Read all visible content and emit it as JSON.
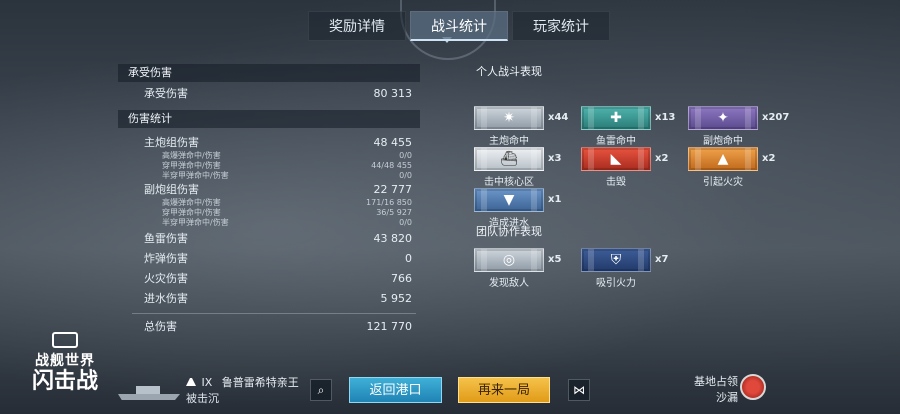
{
  "tabs": [
    "奖励详情",
    "战斗统计",
    "玩家统计"
  ],
  "active_tab": 1,
  "damage_received": {
    "header": "承受伤害",
    "label": "承受伤害",
    "value": "80 313"
  },
  "damage_stats": {
    "header": "伤害统计",
    "main_battery": {
      "label": "主炮组伤害",
      "value": "48 455"
    },
    "main_sub": [
      {
        "label": "高爆弹命中/伤害",
        "value": "0/0"
      },
      {
        "label": "穿甲弹命中/伤害",
        "value": "44/48 455"
      },
      {
        "label": "半穿甲弹命中/伤害",
        "value": "0/0"
      }
    ],
    "secondary": {
      "label": "副炮组伤害",
      "value": "22 777"
    },
    "secondary_sub": [
      {
        "label": "高爆弹命中/伤害",
        "value": "171/16 850"
      },
      {
        "label": "穿甲弹命中/伤害",
        "value": "36/5 927"
      },
      {
        "label": "半穿甲弹命中/伤害",
        "value": "0/0"
      }
    ],
    "others": [
      {
        "label": "鱼雷伤害",
        "value": "43 820"
      },
      {
        "label": "炸弹伤害",
        "value": "0"
      },
      {
        "label": "火灾伤害",
        "value": "766"
      },
      {
        "label": "进水伤害",
        "value": "5 952"
      }
    ],
    "total": {
      "label": "总伤害",
      "value": "121 770"
    }
  },
  "personal": {
    "header": "个人战斗表现",
    "medals": [
      {
        "label": "主炮命中",
        "count": "x44",
        "icon": "shell-icon"
      },
      {
        "label": "鱼雷命中",
        "count": "x13",
        "icon": "torpedo-icon"
      },
      {
        "label": "副炮命中",
        "count": "x207",
        "icon": "secondary-gun-icon"
      },
      {
        "label": "击中核心区",
        "count": "x3",
        "icon": "citadel-icon"
      },
      {
        "label": "击毁",
        "count": "x2",
        "icon": "destroyed-icon"
      },
      {
        "label": "引起火灾",
        "count": "x2",
        "icon": "fire-icon"
      },
      {
        "label": "造成进水",
        "count": "x1",
        "icon": "flooding-icon"
      }
    ]
  },
  "team": {
    "header": "团队协作表现",
    "medals": [
      {
        "label": "发现敌人",
        "count": "x5",
        "icon": "spotting-icon"
      },
      {
        "label": "吸引火力",
        "count": "x7",
        "icon": "tank-fire-icon"
      }
    ]
  },
  "logo": {
    "line1": "战舰世界",
    "line2": "闪击战"
  },
  "ship": {
    "tier": "IX",
    "name": "鲁普雷希特亲王",
    "status": "被击沉"
  },
  "buttons": {
    "return": "返回港口",
    "again": "再来一局"
  },
  "capture": {
    "line1": "基地占领",
    "line2": "沙漏"
  }
}
